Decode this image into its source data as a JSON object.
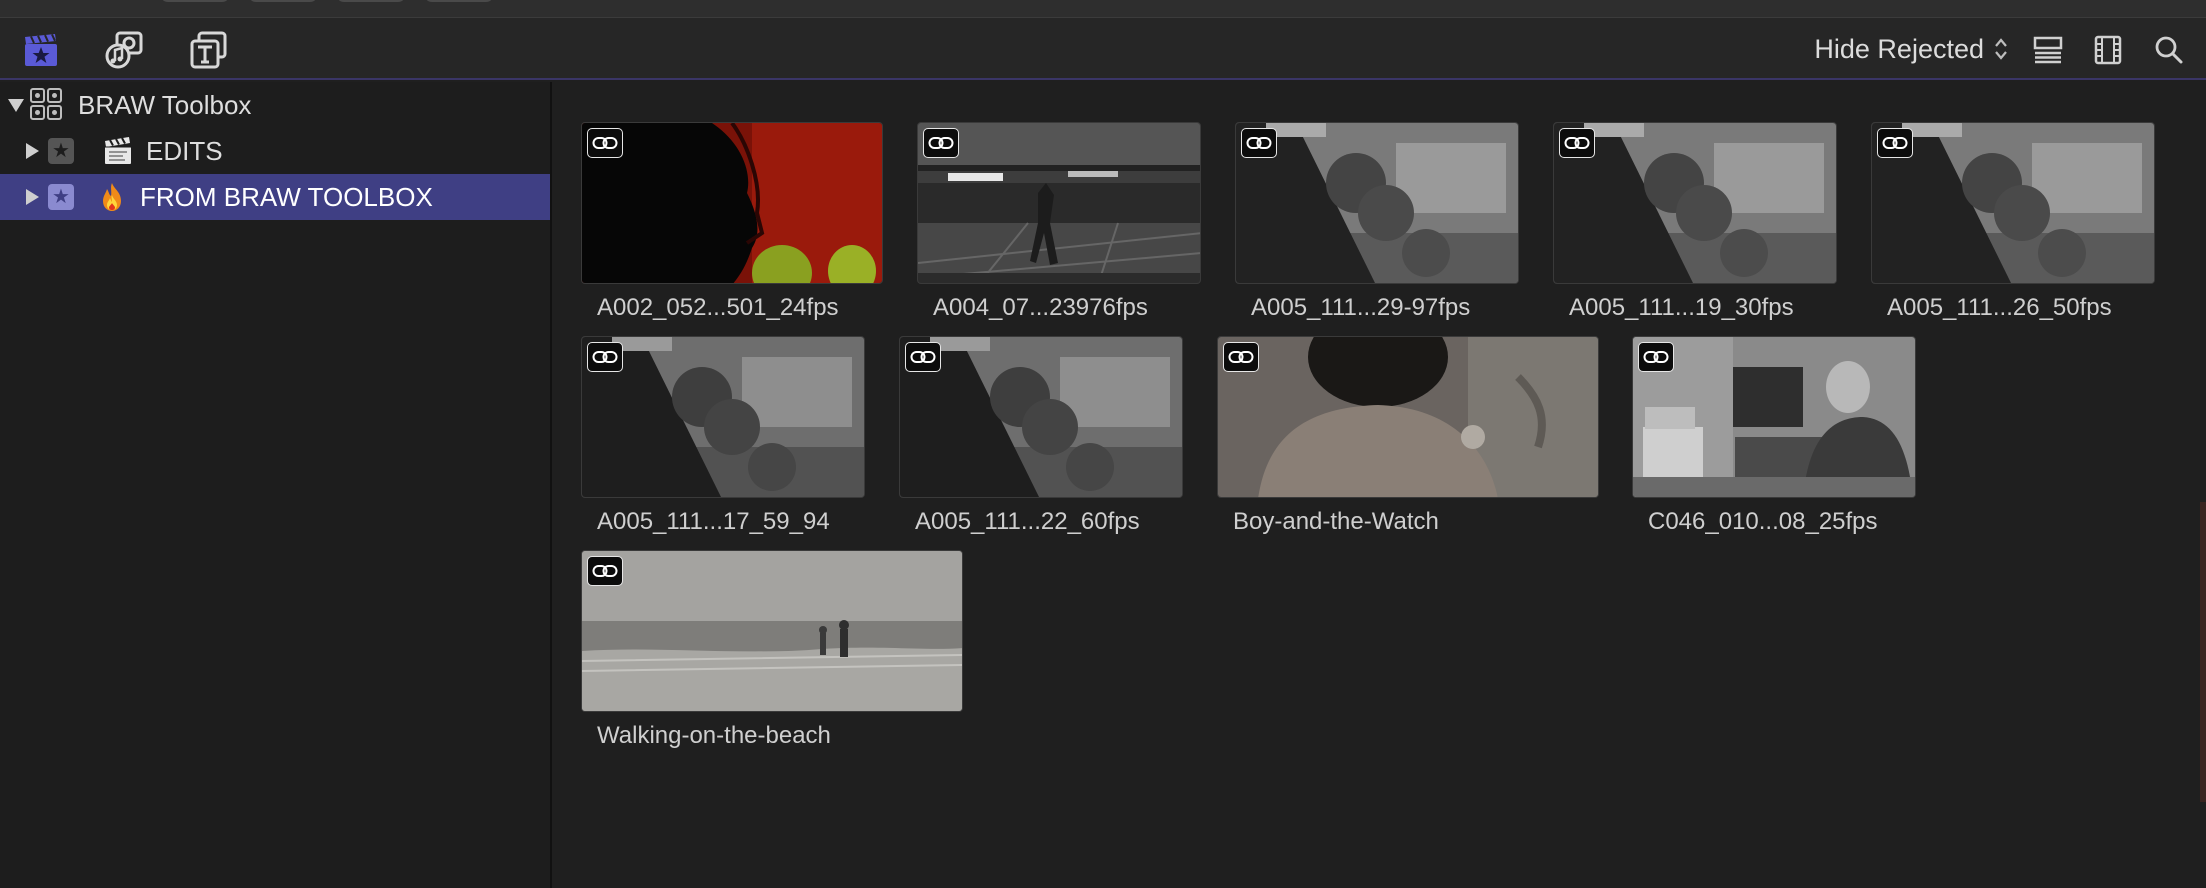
{
  "toolbar": {
    "left_icons": [
      {
        "name": "libraries-icon",
        "active": true
      },
      {
        "name": "photos-and-audio-icon",
        "active": false
      },
      {
        "name": "titles-and-generators-icon",
        "active": false
      }
    ],
    "filter_label": "Hide Rejected",
    "right_icons": [
      "list-view-icon",
      "filmstrip-view-icon",
      "search-icon"
    ],
    "accent_color": "#5a5ad6"
  },
  "sidebar": {
    "library": {
      "label": "BRAW Toolbox",
      "expanded": true
    },
    "items": [
      {
        "label": "EDITS",
        "icon": "clapperboard-icon",
        "selected": false
      },
      {
        "label": "FROM BRAW TOOLBOX",
        "icon": "fire-icon",
        "selected": true
      }
    ],
    "selection_color": "#3f3f84"
  },
  "clips": [
    {
      "name": "A002_052...501_24fps",
      "icon": "link-icon"
    },
    {
      "name": "A004_07...23976fps",
      "icon": "link-icon"
    },
    {
      "name": "A005_111...29-97fps",
      "icon": "link-icon"
    },
    {
      "name": "A005_111...19_30fps",
      "icon": "link-icon"
    },
    {
      "name": "A005_111...26_50fps",
      "icon": "link-icon"
    },
    {
      "name": "A005_111...17_59_94",
      "icon": "link-icon"
    },
    {
      "name": "A005_111...22_60fps",
      "icon": "link-icon"
    },
    {
      "name": "Boy-and-the-Watch",
      "icon": "link-icon"
    },
    {
      "name": "C046_010...08_25fps",
      "icon": "link-icon"
    },
    {
      "name": "Walking-on-the-beach",
      "icon": "link-icon"
    }
  ]
}
